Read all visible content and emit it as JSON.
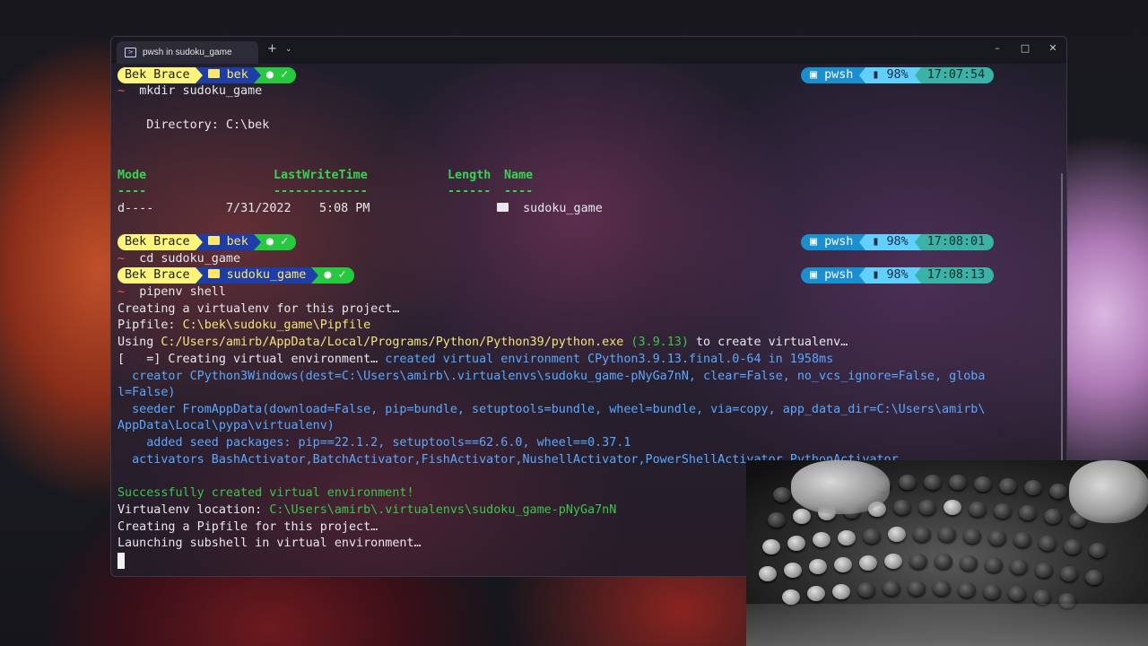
{
  "window": {
    "tab_title": "pwsh in sudoku_game",
    "tab_icon": "terminal-icon",
    "new_tab": "+",
    "dropdown": "⌄",
    "controls": {
      "minimize": "–",
      "maximize": "□",
      "close": "✕"
    }
  },
  "prompts": [
    {
      "user": "Bek Brace",
      "path": "bek",
      "git": "✓",
      "shell": "pwsh",
      "battery": "98%",
      "time": "17:07:54",
      "command": "mkdir sudoku_game"
    },
    {
      "user": "Bek Brace",
      "path": "bek",
      "git": "✓",
      "shell": "pwsh",
      "battery": "98%",
      "time": "17:08:01",
      "command": "cd sudoku_game"
    },
    {
      "user": "Bek Brace",
      "path": "sudoku_game",
      "git": "✓",
      "shell": "pwsh",
      "battery": "98%",
      "time": "17:08:13",
      "command": "pipenv shell"
    }
  ],
  "prompt_symbol": "~",
  "mkdir_output": {
    "directory_line": "    Directory: C:\\bek",
    "headers": {
      "mode": "Mode",
      "lastwrite": "LastWriteTime",
      "length": "Length",
      "name": "Name"
    },
    "underlines": {
      "mode": "----",
      "lastwrite": "-------------",
      "length": "------",
      "name": "----"
    },
    "row": {
      "mode": "d----",
      "date": "7/31/2022",
      "time": "5:08 PM",
      "name": "sudoku_game"
    }
  },
  "pipenv_output": {
    "creating": "Creating a virtualenv for this project…",
    "pipfile_label": "Pipfile: ",
    "pipfile_path": "C:\\bek\\sudoku_game\\Pipfile",
    "using_label": "Using ",
    "python_path": "C:/Users/amirb/AppData/Local/Programs/Python/Python39/python.exe",
    "python_version": "(3.9.13)",
    "using_suffix": " to create virtualenv…",
    "progress_prefix": "[   =] Creating virtual environment…",
    "progress_result": "created virtual environment CPython3.9.13.final.0-64 in 1958ms",
    "creator_1": "  creator CPython3Windows(dest=C:\\Users\\amirb\\.virtualenvs\\sudoku_game-pNyGa7nN, clear=False, no_vcs_ignore=False, globa",
    "creator_2": "l=False)",
    "seeder_1": "  seeder FromAppData(download=False, pip=bundle, setuptools=bundle, wheel=bundle, via=copy, app_data_dir=C:\\Users\\amirb\\",
    "seeder_2": "AppData\\Local\\pypa\\virtualenv)",
    "added": "    added seed packages: pip==22.1.2, setuptools==62.6.0, wheel==0.37.1",
    "activators": "  activators BashActivator,BatchActivator,FishActivator,NushellActivator,PowerShellActivator,PythonActivator",
    "success": "Successfully created virtual environment!",
    "location_label": "Virtualenv location: ",
    "location_path": "C:\\Users\\amirb\\.virtualenvs\\sudoku_game-pNyGa7nN",
    "creating_pipfile": "Creating a Pipfile for this project…",
    "launching": "Launching subshell in virtual environment…"
  },
  "colors": {
    "user_segment": "#fff57a",
    "path_segment": "#1d3ea8",
    "git_segment": "#27c93f",
    "shell_segment": "#1a8fcf",
    "battery_segment": "#5fd0ff",
    "time_segment": "#3ab3a6"
  }
}
